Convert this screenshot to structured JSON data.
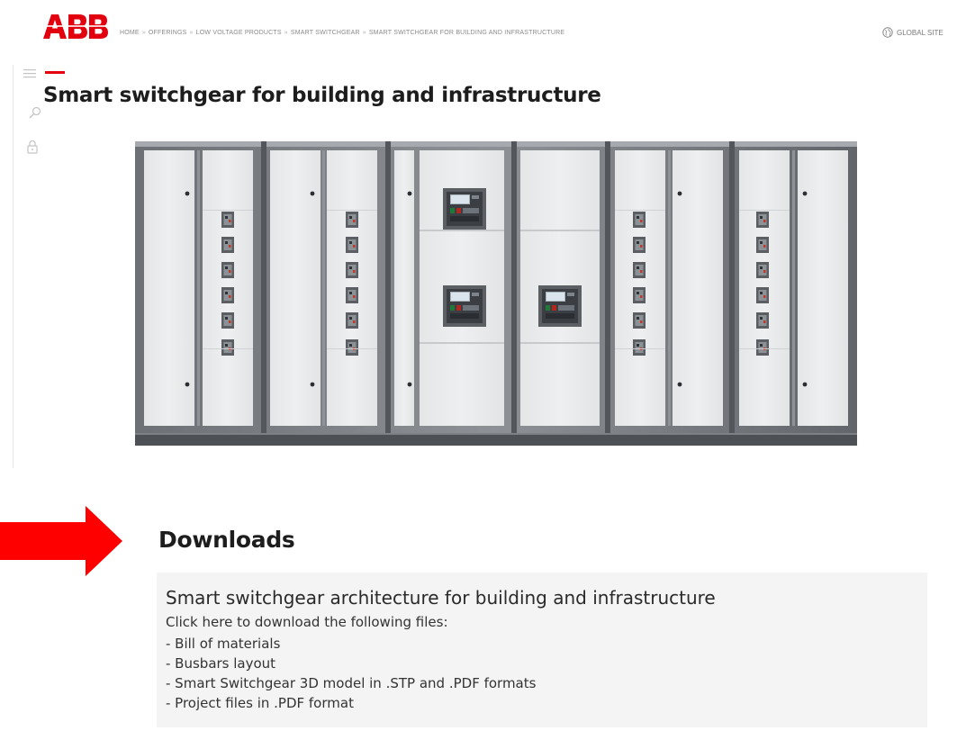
{
  "header": {
    "logo_text": "ABB",
    "breadcrumb": [
      "HOME",
      "OFFERINGS",
      "LOW VOLTAGE PRODUCTS",
      "SMART SWITCHGEAR",
      "SMART SWITCHGEAR FOR BUILDING AND INFRASTRUCTURE"
    ],
    "breadcrumb_separator": "»",
    "global_site_label": "GLOBAL SITE"
  },
  "rail": {
    "icons": [
      "menu-icon",
      "search-icon",
      "lock-icon"
    ]
  },
  "page": {
    "title": "Smart switchgear for building and infrastructure",
    "hero_image_alt": "Smart switchgear lineup"
  },
  "downloads": {
    "heading": "Downloads",
    "item_title": "Smart switchgear architecture for building and infrastructure",
    "intro": "Click here to download the following files:",
    "files": [
      "- Bill of materials",
      "- Busbars layout",
      "- Smart Switchgear 3D model in .STP and .PDF formats",
      "- Project files in .PDF format"
    ]
  },
  "colors": {
    "brand_red": "#e2000f",
    "arrow_red": "#ff0000",
    "box_bg": "#f4f4f4"
  }
}
